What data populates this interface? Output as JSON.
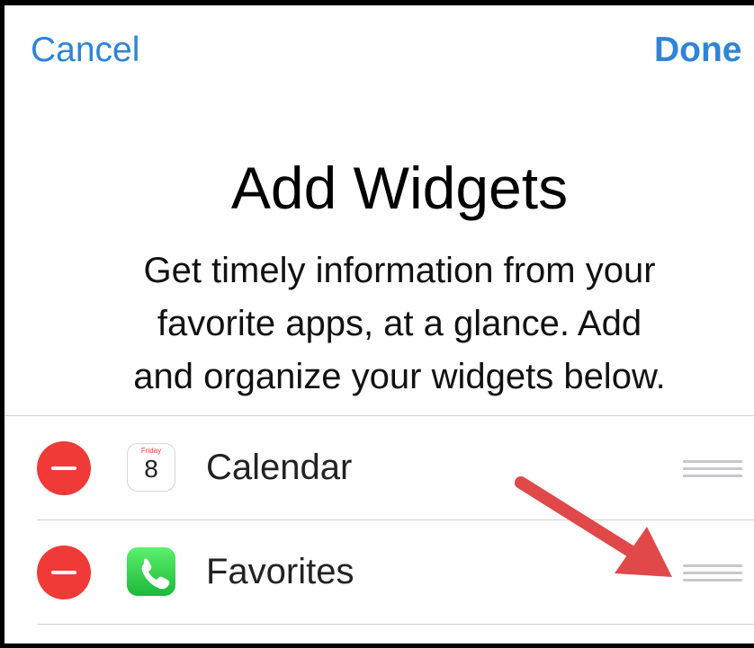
{
  "nav": {
    "cancel_label": "Cancel",
    "done_label": "Done"
  },
  "header": {
    "title": "Add Widgets",
    "description_lines": [
      "Get timely information from your",
      "favorite apps, at a glance. Add",
      "and organize your widgets below."
    ]
  },
  "widgets": [
    {
      "label": "Calendar",
      "icon": "calendar-icon",
      "icon_day_label": "Friday",
      "icon_date": "8"
    },
    {
      "label": "Favorites",
      "icon": "phone-icon"
    }
  ],
  "colors": {
    "accent": "#2f84d8",
    "delete": "#f03a37",
    "annotation_arrow": "#e0484a",
    "separator": "#cfcfd3"
  }
}
